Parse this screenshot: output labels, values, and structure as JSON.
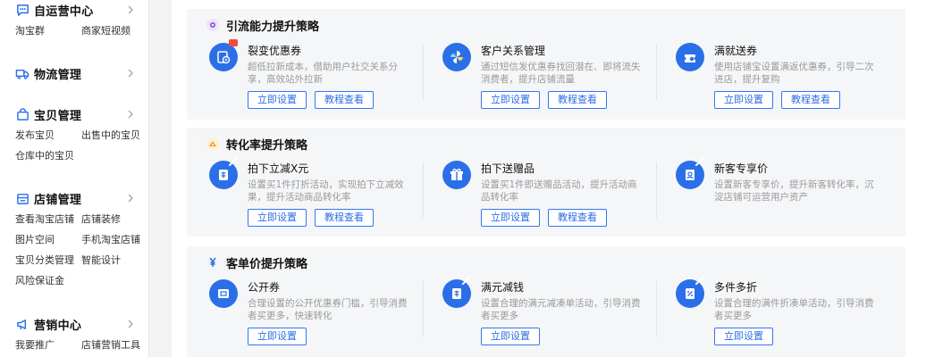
{
  "sidebar": {
    "sections": [
      {
        "title": "自运营中心",
        "icon": "chat-bubble-icon",
        "rows": [
          [
            "淘宝群",
            "商家短视频"
          ]
        ]
      },
      {
        "title": "物流管理",
        "icon": "truck-icon",
        "rows": []
      },
      {
        "title": "宝贝管理",
        "icon": "bag-icon",
        "rows": [
          [
            "发布宝贝",
            "出售中的宝贝"
          ],
          [
            "仓库中的宝贝"
          ]
        ]
      },
      {
        "title": "店铺管理",
        "icon": "store-icon",
        "rows": [
          [
            "查看淘宝店铺",
            "店铺装修"
          ],
          [
            "图片空间",
            "手机淘宝店铺"
          ],
          [
            "宝贝分类管理",
            "智能设计"
          ],
          [
            "风险保证金"
          ]
        ]
      },
      {
        "title": "营销中心",
        "icon": "megaphone-icon",
        "rows": [
          [
            "我要推广",
            "店铺营销工具"
          ]
        ]
      }
    ]
  },
  "panels": [
    {
      "title": "引流能力提升策略",
      "icon_color": "#8a5bd8",
      "cards": [
        {
          "title": "裂变优惠券",
          "desc": "超低拉新成本，借助用户社交关系分享，高效站外拉新",
          "buttons": [
            "立即设置",
            "教程查看"
          ],
          "icon": "coupon-icon"
        },
        {
          "title": "客户关系管理",
          "desc": "通过短信发优惠券找回潜在、即将流失消费者，提升店铺流量",
          "buttons": [
            "立即设置",
            "教程查看"
          ],
          "icon": "pinwheel-icon"
        },
        {
          "title": "满就送券",
          "desc": "使用店铺宝设置满返优惠券，引导二次进店，提升复购",
          "buttons": [
            "立即设置",
            "教程查看"
          ],
          "icon": "gift-coupon-icon"
        }
      ]
    },
    {
      "title": "转化率提升策略",
      "icon_color": "#f0a020",
      "cards": [
        {
          "title": "拍下立减X元",
          "desc": "设置买1件打折活动，实现拍下立减效果，提升活动商品转化率",
          "buttons": [
            "立即设置",
            "教程查看"
          ],
          "icon": "discount-tag-icon"
        },
        {
          "title": "拍下送赠品",
          "desc": "设置买1件即送赠品活动，提升活动商品转化率",
          "buttons": [
            "立即设置",
            "教程查看"
          ],
          "icon": "gift-icon"
        },
        {
          "title": "新客专享价",
          "desc": "设置新客专享价，提升新客转化率，沉淀店铺可运营用户资产",
          "buttons": [],
          "icon": "new-user-icon"
        }
      ]
    },
    {
      "title": "客单价提升策略",
      "icon_color": "#2b6fe8",
      "cards": [
        {
          "title": "公开券",
          "desc": "合理设置的公开优惠券门槛，引导消费者买更多，快速转化",
          "buttons": [
            "立即设置"
          ],
          "icon": "ticket-icon"
        },
        {
          "title": "满元减钱",
          "desc": "设置合理的满元减凑单活动，引导消费者买更多",
          "buttons": [
            "立即设置"
          ],
          "icon": "reduce-icon"
        },
        {
          "title": "多件多折",
          "desc": "设置合理的满件折凑单活动，引导消费者买更多",
          "buttons": [
            "立即设置"
          ],
          "icon": "multi-discount-icon"
        }
      ]
    }
  ]
}
